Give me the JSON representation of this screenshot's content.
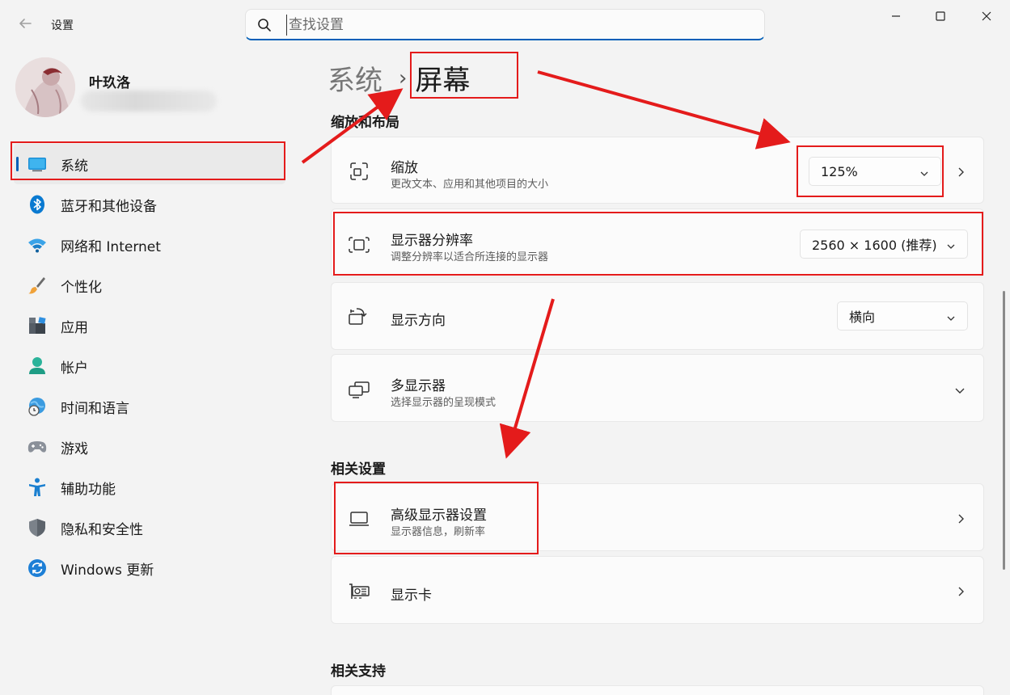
{
  "window": {
    "app_title": "设置",
    "back_icon": "back-arrow-icon"
  },
  "search": {
    "placeholder": "查找设置",
    "value": ""
  },
  "user": {
    "name": "叶玖洛"
  },
  "sidebar": {
    "items": [
      {
        "label": "系统",
        "icon": "system-display-icon",
        "active": true
      },
      {
        "label": "蓝牙和其他设备",
        "icon": "bluetooth-icon"
      },
      {
        "label": "网络和 Internet",
        "icon": "wifi-icon"
      },
      {
        "label": "个性化",
        "icon": "brush-icon"
      },
      {
        "label": "应用",
        "icon": "apps-icon"
      },
      {
        "label": "帐户",
        "icon": "account-icon"
      },
      {
        "label": "时间和语言",
        "icon": "globe-clock-icon"
      },
      {
        "label": "游戏",
        "icon": "gamepad-icon"
      },
      {
        "label": "辅助功能",
        "icon": "accessibility-icon"
      },
      {
        "label": "隐私和安全性",
        "icon": "shield-icon"
      },
      {
        "label": "Windows 更新",
        "icon": "update-icon"
      }
    ]
  },
  "breadcrumb": {
    "parent": "系统",
    "separator": "›",
    "current": "屏幕"
  },
  "sections": {
    "scale_layout": "缩放和布局",
    "related_settings": "相关设置",
    "related_support": "相关支持"
  },
  "settings": {
    "scale": {
      "title": "缩放",
      "subtitle": "更改文本、应用和其他项目的大小",
      "value": "125%"
    },
    "resolution": {
      "title": "显示器分辨率",
      "subtitle": "调整分辨率以适合所连接的显示器",
      "value": "2560 × 1600 (推荐)"
    },
    "orientation": {
      "title": "显示方向",
      "value": "横向"
    },
    "multi_display": {
      "title": "多显示器",
      "subtitle": "选择显示器的呈现模式"
    },
    "advanced_display": {
      "title": "高级显示器设置",
      "subtitle": "显示器信息，刷新率"
    },
    "graphics": {
      "title": "显示卡"
    }
  },
  "colors": {
    "accent": "#005fb8",
    "annotation_red": "#e41b1b",
    "background": "#f3f3f3",
    "card": "#fbfbfb"
  }
}
